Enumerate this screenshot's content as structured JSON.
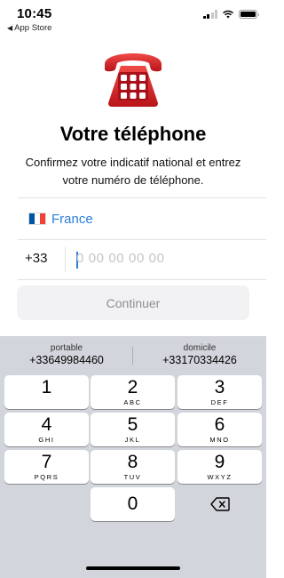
{
  "status_bar": {
    "time": "10:45",
    "back_label": "App Store"
  },
  "header": {
    "title": "Votre téléphone",
    "subtitle": "Confirmez votre indicatif national et entrez votre numéro de téléphone."
  },
  "country": {
    "name": "France",
    "flag_colors": [
      "#0055a4",
      "#ffffff",
      "#ef4135"
    ]
  },
  "phone": {
    "code": "+33",
    "value": "",
    "placeholder": "0 00 00 00 00"
  },
  "continue_label": "Continuer",
  "suggestions": [
    {
      "label": "portable",
      "number": "+33649984460"
    },
    {
      "label": "domicile",
      "number": "+33170334426"
    }
  ],
  "keypad": {
    "k1": {
      "digit": "1",
      "letters": ""
    },
    "k2": {
      "digit": "2",
      "letters": "ABC"
    },
    "k3": {
      "digit": "3",
      "letters": "DEF"
    },
    "k4": {
      "digit": "4",
      "letters": "GHI"
    },
    "k5": {
      "digit": "5",
      "letters": "JKL"
    },
    "k6": {
      "digit": "6",
      "letters": "MNO"
    },
    "k7": {
      "digit": "7",
      "letters": "PQRS"
    },
    "k8": {
      "digit": "8",
      "letters": "TUV"
    },
    "k9": {
      "digit": "9",
      "letters": "WXYZ"
    },
    "k0": {
      "digit": "0",
      "letters": ""
    }
  },
  "colors": {
    "accent": "#2a7fd8",
    "phone_red": "#d8252a",
    "keyboard_bg": "#d2d5db"
  }
}
